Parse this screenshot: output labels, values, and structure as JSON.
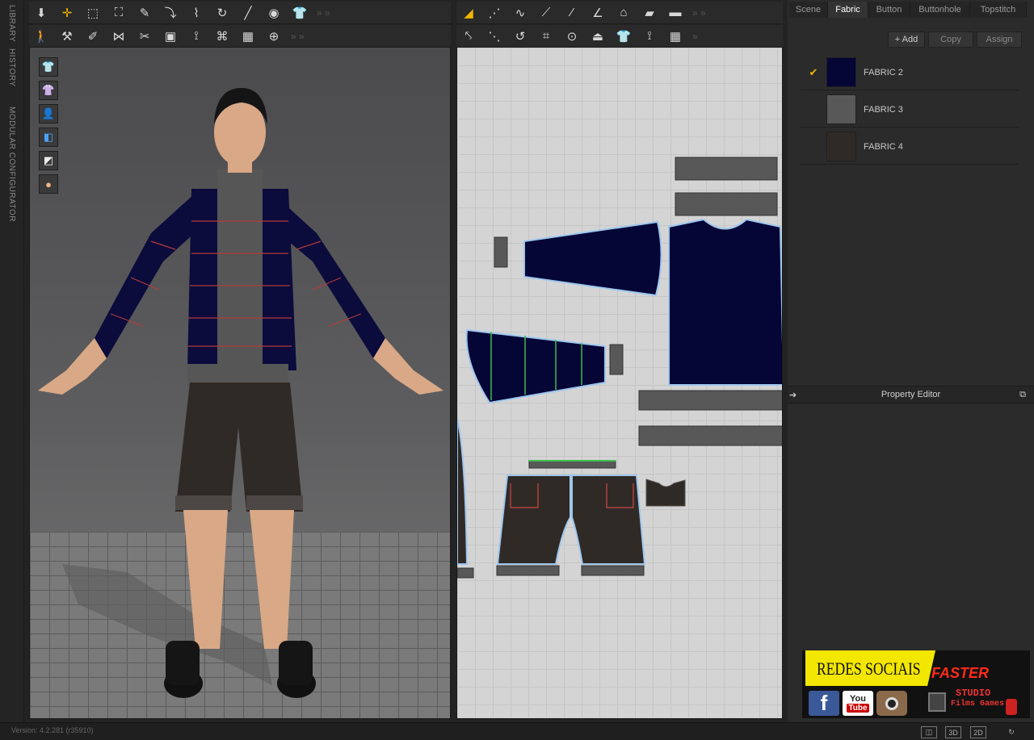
{
  "sidebar": {
    "tabs": [
      "LIBRARY",
      "HISTORY",
      "MODULAR CONFIGURATOR"
    ]
  },
  "toolbar_3d": {
    "row1": [
      "arrow-down-icon",
      "move-icon",
      "box-select-icon",
      "transform-icon",
      "edit-icon",
      "fold-icon",
      "pin-icon",
      "tack-icon",
      "needle-icon",
      "measure-icon",
      "shirt-icon"
    ],
    "row2": [
      "avatar-walk-icon",
      "wrench-icon",
      "tape-icon",
      "stitch-icon",
      "cut-icon",
      "fabric-icon",
      "sew-icon",
      "pattern-icon",
      "shirt-plaid-icon",
      "button-icon"
    ]
  },
  "toolbar_2d": {
    "row1": [
      "pen-icon",
      "segment-icon",
      "curve-icon",
      "point-icon",
      "line-icon",
      "angle-icon",
      "house-icon",
      "folder-icon",
      "rectangle-icon"
    ],
    "row2": [
      "transform-2d-icon",
      "edit-2d-icon",
      "rotate-2d-icon",
      "cut-2d-icon",
      "lock-icon",
      "iron-icon",
      "shirt-2d-icon",
      "stitch-2d-icon",
      "topstitch-icon"
    ]
  },
  "view3d_tools": [
    "shirt-view-icon",
    "shirt-texture-icon",
    "avatar-view-icon",
    "cube-view-icon",
    "hanger-icon",
    "skin-icon"
  ],
  "right_panel": {
    "tabs": [
      "Scene",
      "Fabric",
      "Button",
      "Buttonhole",
      "Topstitch"
    ],
    "active_tab": "Fabric",
    "actions": {
      "add": "+ Add",
      "copy": "Copy",
      "assign": "Assign"
    },
    "fabrics": [
      {
        "name": "FABRIC 2",
        "color": "#050536",
        "selected": true
      },
      {
        "name": "FABRIC 3",
        "color": "#585858",
        "selected": false
      },
      {
        "name": "FABRIC 4",
        "color": "#302a27",
        "selected": false
      }
    ],
    "property_editor": "Property Editor"
  },
  "banner": {
    "title": "REDES SOCIAIS",
    "brand": "FASTER",
    "brand_sub": "STUDIO",
    "brand_sub2": "Films Games",
    "youtube_top": "You",
    "youtube_bottom": "Tube"
  },
  "status": {
    "version": "Version: 4.2.281 (r35910)",
    "view_3d": "3D",
    "view_2d": "2D"
  },
  "colors": {
    "accent": "#f0b400",
    "jacket": "#050536",
    "shorts": "#302a27",
    "trim": "#585858"
  }
}
